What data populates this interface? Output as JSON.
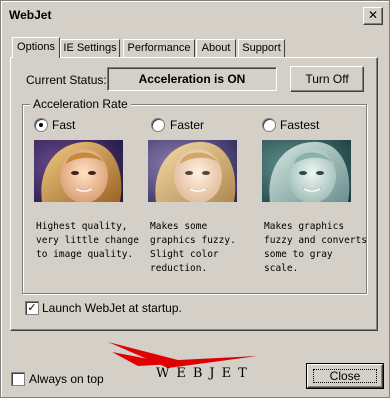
{
  "window": {
    "title": "WebJet",
    "close_glyph": "✕"
  },
  "tabs": [
    {
      "label": "Options",
      "active": true
    },
    {
      "label": "IE Settings",
      "active": false
    },
    {
      "label": "Performance",
      "active": false
    },
    {
      "label": "About",
      "active": false
    },
    {
      "label": "Support",
      "active": false
    }
  ],
  "status": {
    "label": "Current Status:",
    "value": "Acceleration is ON",
    "button": "Turn Off"
  },
  "acceleration": {
    "legend": "Acceleration Rate",
    "options": [
      {
        "label": "Fast",
        "selected": true,
        "description": [
          "Highest quality,",
          "very little change",
          "to image quality."
        ]
      },
      {
        "label": "Faster",
        "selected": false,
        "description": [
          "Makes some",
          "graphics fuzzy.",
          "Slight color",
          "reduction."
        ]
      },
      {
        "label": "Fastest",
        "selected": false,
        "description": [
          "Makes graphics",
          "fuzzy and converts",
          "some to gray",
          "scale."
        ]
      }
    ]
  },
  "startup": {
    "label": "Launch WebJet at startup.",
    "checked": true
  },
  "footer": {
    "always_on_top": "Always on top",
    "always_on_top_checked": false,
    "close_button": "Close",
    "logo_text": "WEBJET"
  },
  "colors": {
    "face": "#d4d0c8",
    "logo_red": "#e00000"
  }
}
